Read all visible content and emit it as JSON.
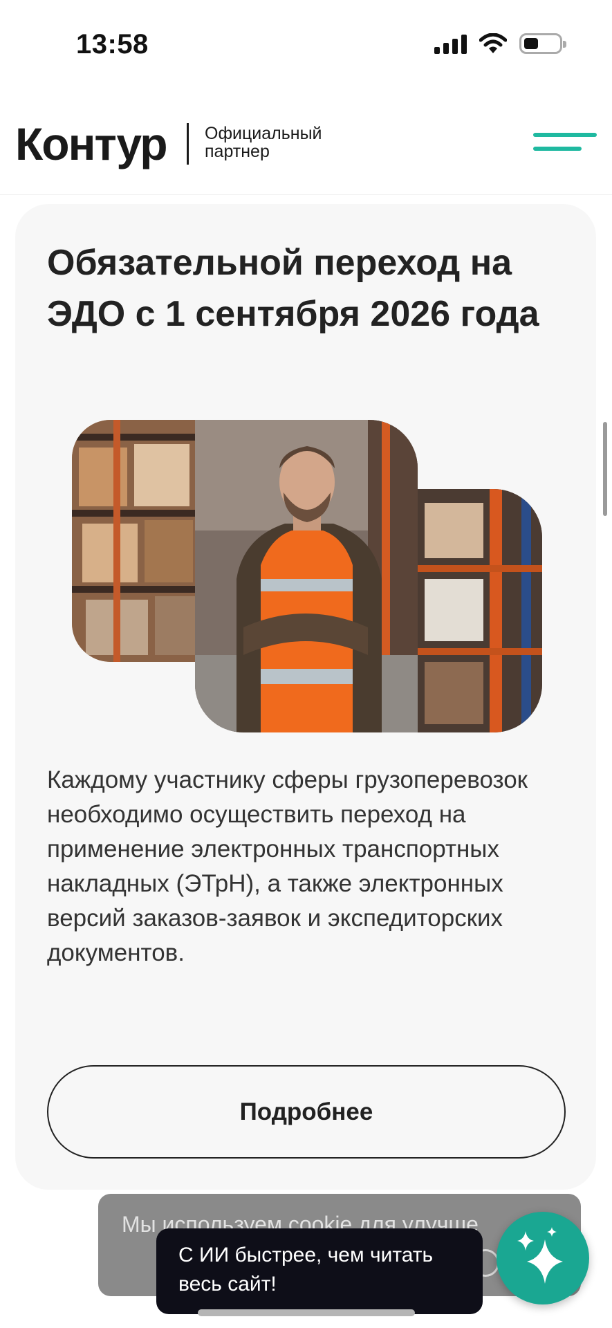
{
  "status_bar": {
    "time": "13:58"
  },
  "header": {
    "logo": "Контур",
    "partner_line1": "Официальный",
    "partner_line2": "партнер",
    "menu_icon": "hamburger-menu-icon",
    "accent_color": "#1fb9a0"
  },
  "card": {
    "title": "Обязательной переход на ЭДО с 1 сентября 2026 года",
    "hero_image": "warehouse-worker-image",
    "text": "Каждому участнику сферы грузоперевозок необходимо осуществить переход на применение электронных транспортных накладных (ЭТрН), а также электронных версий заказов-заявок и экспедиторских документов.",
    "button_label": "Подробнее"
  },
  "cookie_banner": {
    "text": "Мы используем cookie для улучше"
  },
  "ai_assistant": {
    "tooltip_line1": "С ИИ быстрее, чем читать",
    "tooltip_line2": "весь сайт!",
    "icon": "sparkles-icon",
    "button_color": "#1aa792"
  }
}
